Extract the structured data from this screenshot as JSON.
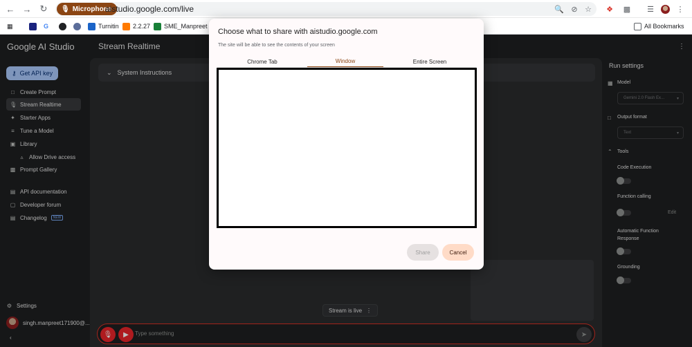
{
  "browser": {
    "permission_chip": "Microphone",
    "url": "aistudio.google.com/live",
    "bookmarks": [
      {
        "label": "Turnitin",
        "color": "#1b64c8"
      },
      {
        "label": "2.2.27",
        "color": "#ff7a00"
      },
      {
        "label": "SME_Manpreet - G",
        "color": "#188038"
      }
    ],
    "all_bookmarks_label": "All Bookmarks"
  },
  "app": {
    "brand": "Google AI Studio",
    "page_title": "Stream Realtime",
    "get_api_key": "Get API key",
    "nav": [
      {
        "label": "Create Prompt",
        "icon": "chat-add-icon"
      },
      {
        "label": "Stream Realtime",
        "icon": "microphone-icon",
        "active": true
      },
      {
        "label": "Starter Apps",
        "icon": "spark-icon"
      },
      {
        "label": "Tune a Model",
        "icon": "tune-icon"
      },
      {
        "label": "Library",
        "icon": "folder-icon"
      },
      {
        "label": "Allow Drive access",
        "icon": "drive-icon",
        "sub": true
      },
      {
        "label": "Prompt Gallery",
        "icon": "gallery-icon"
      }
    ],
    "nav_secondary": [
      {
        "label": "API documentation",
        "icon": "doc-icon"
      },
      {
        "label": "Developer forum",
        "icon": "forum-icon"
      },
      {
        "label": "Changelog",
        "icon": "changelog-icon",
        "badge": "NEW"
      }
    ],
    "settings_label": "Settings",
    "account": "singh.manpreet171900@...",
    "system_instructions": "System Instructions",
    "stream_status": "Stream is live",
    "input_placeholder": "Type something"
  },
  "run_settings": {
    "title": "Run settings",
    "model_label": "Model",
    "model_value": "Gemini 2.0 Flash Ex...",
    "output_format_label": "Output format",
    "output_format_value": "Text",
    "tools_label": "Tools",
    "code_execution": "Code Execution",
    "function_calling": "Function calling",
    "edit": "Edit",
    "auto_function_line1": "Automatic Function",
    "auto_function_line2": "Response",
    "grounding": "Grounding"
  },
  "dialog": {
    "title": "Choose what to share with aistudio.google.com",
    "subtitle": "The site will be able to see the contents of your screen",
    "tabs": [
      "Chrome Tab",
      "Window",
      "Entire Screen"
    ],
    "selected_tab": "Window",
    "share": "Share",
    "cancel": "Cancel"
  }
}
